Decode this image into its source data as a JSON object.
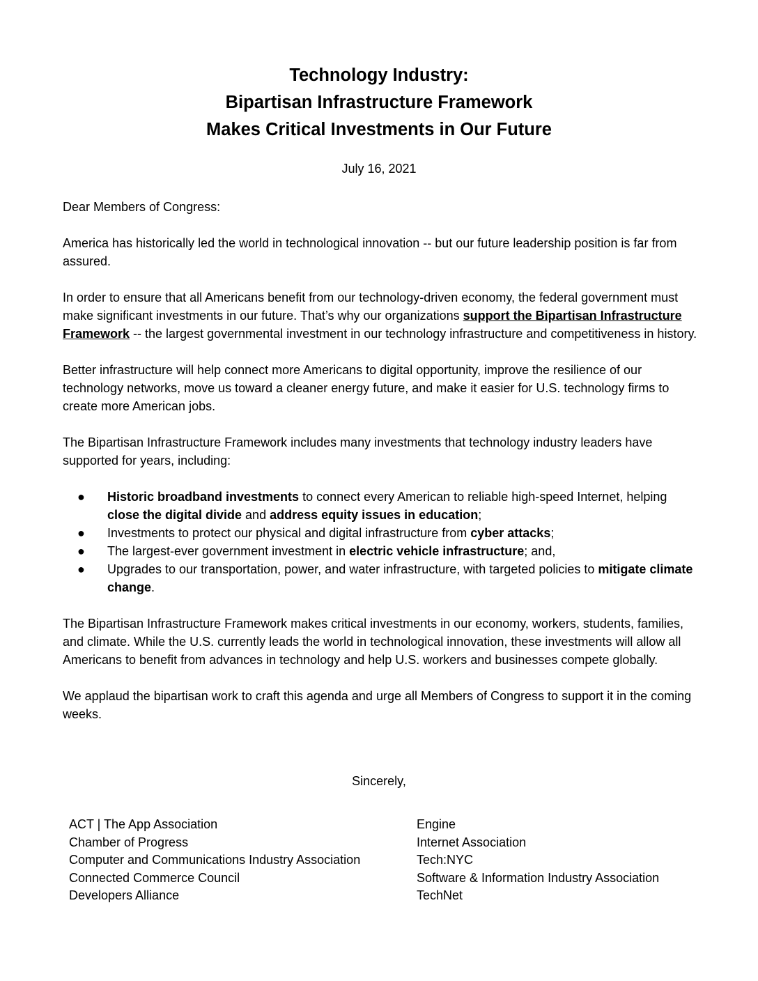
{
  "title": {
    "line1": "Technology Industry:",
    "line2": "Bipartisan Infrastructure Framework",
    "line3": "Makes Critical Investments in Our Future"
  },
  "date": "July 16, 2021",
  "salutation": "Dear Members of Congress:",
  "para1": "America has historically led the world in technological innovation -- but our future leadership position is far from assured.",
  "para2": {
    "before": "In order to ensure that all Americans benefit from our technology-driven economy, the federal government must make significant investments in our future.  That’s why our organizations ",
    "link": "support the Bipartisan Infrastructure Framework",
    "after": " -- the largest governmental investment in our technology infrastructure and competitiveness in history."
  },
  "para3": "Better infrastructure will help connect more Americans to digital opportunity, improve the resilience of our technology networks, move us toward a cleaner energy future, and make it easier for U.S. technology firms to create more American jobs.",
  "para4": "The Bipartisan Infrastructure Framework includes many investments that technology industry leaders have supported for years, including:",
  "bullet_glyph": "●",
  "bullets": [
    {
      "b1": "Historic broadband investments",
      "t1": " to connect every American to reliable high-speed Internet, helping ",
      "b2": "close the digital divide",
      "t2": " and ",
      "b3": "address equity issues in education",
      "t3": ";"
    },
    {
      "t1": "Investments to protect our physical and digital infrastructure from ",
      "b1": "cyber attacks",
      "t2": ";"
    },
    {
      "t1": "The largest-ever government investment in ",
      "b1": "electric vehicle infrastructure",
      "t2": "; and,"
    },
    {
      "t1": "Upgrades to our transportation, power, and water infrastructure, with targeted policies to ",
      "b1": "mitigate climate change",
      "t2": "."
    }
  ],
  "para5": "The Bipartisan Infrastructure Framework makes critical investments in our economy, workers, students, families, and climate.  While the U.S. currently leads the world in technological innovation, these investments will allow all Americans to benefit from advances in technology and help U.S. workers and businesses compete globally.",
  "para6": "We applaud the bipartisan work to craft this agenda and urge all Members of Congress to support it in the coming weeks.",
  "closing": "Sincerely,",
  "signers_left": [
    "ACT | The App Association",
    "Chamber of Progress",
    "Computer and Communications Industry Association",
    "Connected Commerce Council",
    "Developers Alliance"
  ],
  "signers_right": [
    "Engine",
    "Internet Association",
    "Tech:NYC",
    "Software & Information Industry Association",
    "TechNet"
  ]
}
